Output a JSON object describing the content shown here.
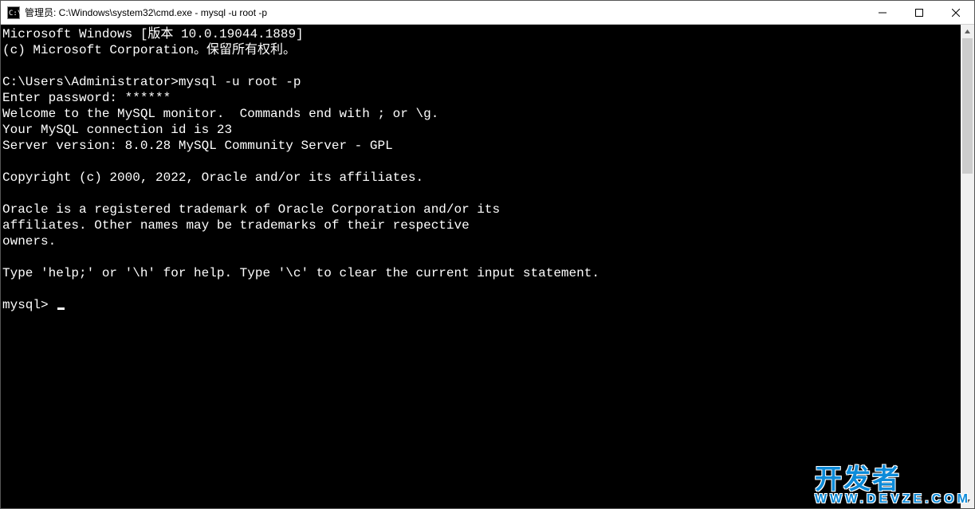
{
  "titlebar": {
    "title": "管理员: C:\\Windows\\system32\\cmd.exe - mysql  -u root -p"
  },
  "terminal": {
    "lines": [
      "Microsoft Windows [版本 10.0.19044.1889]",
      "(c) Microsoft Corporation。保留所有权利。",
      "",
      "C:\\Users\\Administrator>mysql -u root -p",
      "Enter password: ******",
      "Welcome to the MySQL monitor.  Commands end with ; or \\g.",
      "Your MySQL connection id is 23",
      "Server version: 8.0.28 MySQL Community Server - GPL",
      "",
      "Copyright (c) 2000, 2022, Oracle and/or its affiliates.",
      "",
      "Oracle is a registered trademark of Oracle Corporation and/or its",
      "affiliates. Other names may be trademarks of their respective",
      "owners.",
      "",
      "Type 'help;' or '\\h' for help. Type '\\c' to clear the current input statement.",
      ""
    ],
    "prompt": "mysql> "
  },
  "watermark": {
    "cn": "开发者",
    "en": "WWW.DEVZE.COM"
  }
}
